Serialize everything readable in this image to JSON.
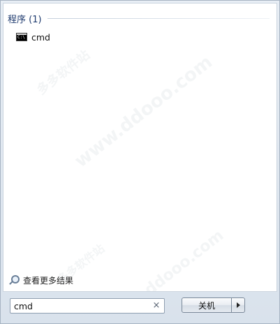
{
  "results": {
    "group_title": "程序 (1)",
    "items": [
      {
        "label": "cmd",
        "icon": "command-prompt-icon"
      }
    ]
  },
  "see_more": {
    "label": "查看更多结果",
    "icon": "search-icon"
  },
  "search": {
    "value": "cmd",
    "clear_icon": "×"
  },
  "shutdown": {
    "label": "关机",
    "arrow_icon": "chevron-right-icon"
  },
  "watermark": {
    "text": "www.ddooo.com",
    "brand": "多多软件站"
  },
  "colors": {
    "group_title": "#1e3a6e",
    "panel_background": "#ffffff",
    "frame_background": "#dfe6ee"
  }
}
